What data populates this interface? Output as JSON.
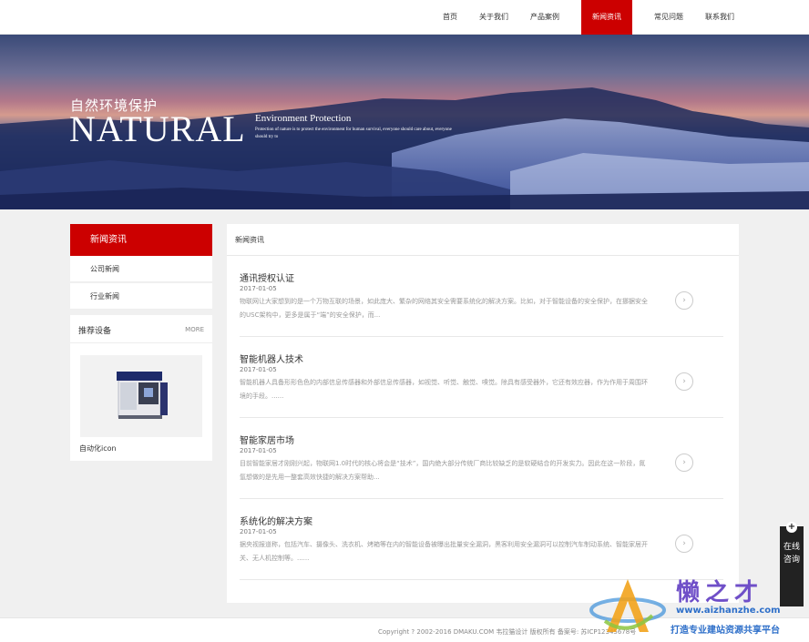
{
  "nav": {
    "items": [
      {
        "label": "首页"
      },
      {
        "label": "关于我们"
      },
      {
        "label": "产品案例"
      },
      {
        "label": "新闻资讯"
      },
      {
        "label": "常见问题"
      },
      {
        "label": "联系我们"
      }
    ],
    "active_index": 3
  },
  "banner": {
    "cn_title": "自然环境保护",
    "big_title": "NATURAL",
    "sub_title": "Environment Protection",
    "small_text": "Protection of nature is to protect the environment for human survival, everyone should care about, everyone should try to"
  },
  "sidebar": {
    "heading": "新闻资讯",
    "items": [
      {
        "label": "公司新闻"
      },
      {
        "label": "行业新闻"
      }
    ]
  },
  "recommend": {
    "title": "推荐设备",
    "more": "MORE",
    "product_label": "自动化icon"
  },
  "main": {
    "title": "新闻资讯",
    "news": [
      {
        "title": "通讯授权认证",
        "date": "2017-01-05",
        "desc": "物联网让大家想到的是一个万物互联的场景，如此庞大、繁杂的网络其安全需要系统化的解决方案。比如，对于智能设备的安全保护，在挪据安全的USC架构中，更多是属于“端”的安全保护，而..."
      },
      {
        "title": "智能机器人技术",
        "date": "2017-01-05",
        "desc": "智能机器人具备形形色色的内部信息传感器和外部信息传感器，如视觉、听觉、触觉、嗅觉。除具有感受器外，它还有效应器，作为作用于周围环境的手段。......"
      },
      {
        "title": "智能家居市场",
        "date": "2017-01-05",
        "desc": "目前智能家居才刚刚兴起，物联网1.0时代的核心将会是“技术”，国内绝大部分传统厂商比较缺乏的是软硬结合的开发实力。因此在这一阶段，氮氩想做的是先用一整套高效快捷的解决方案帮助..."
      },
      {
        "title": "系统化的解决方案",
        "date": "2017-01-05",
        "desc": "据央视报道称，包括汽车、摄像头、洗衣机、烤箱等在内的智能设备被曝出批量安全漏洞，黑客利用安全漏洞可以控制汽车制动系统、智能家居开关、无人机控制等。......"
      }
    ]
  },
  "footer": {
    "copyright": "Copyright ? 2002-2016 DMAKU.COM 韦拉猫设计 版权所有 备案号: 苏ICP12345678号"
  },
  "consult": {
    "label": "在线咨询"
  },
  "watermark": {
    "cn": "懒之才",
    "url": "www.aizhanzhe.com",
    "slogan": "打造专业建站资源共享平台"
  },
  "colors": {
    "accent": "#cc0000",
    "page_bg": "#f0f0f0",
    "watermark_purple": "#6f4fc8",
    "watermark_blue": "#2e6fc9"
  },
  "icons": {
    "arrow": "chevron-right-icon",
    "plus": "plus-icon"
  }
}
